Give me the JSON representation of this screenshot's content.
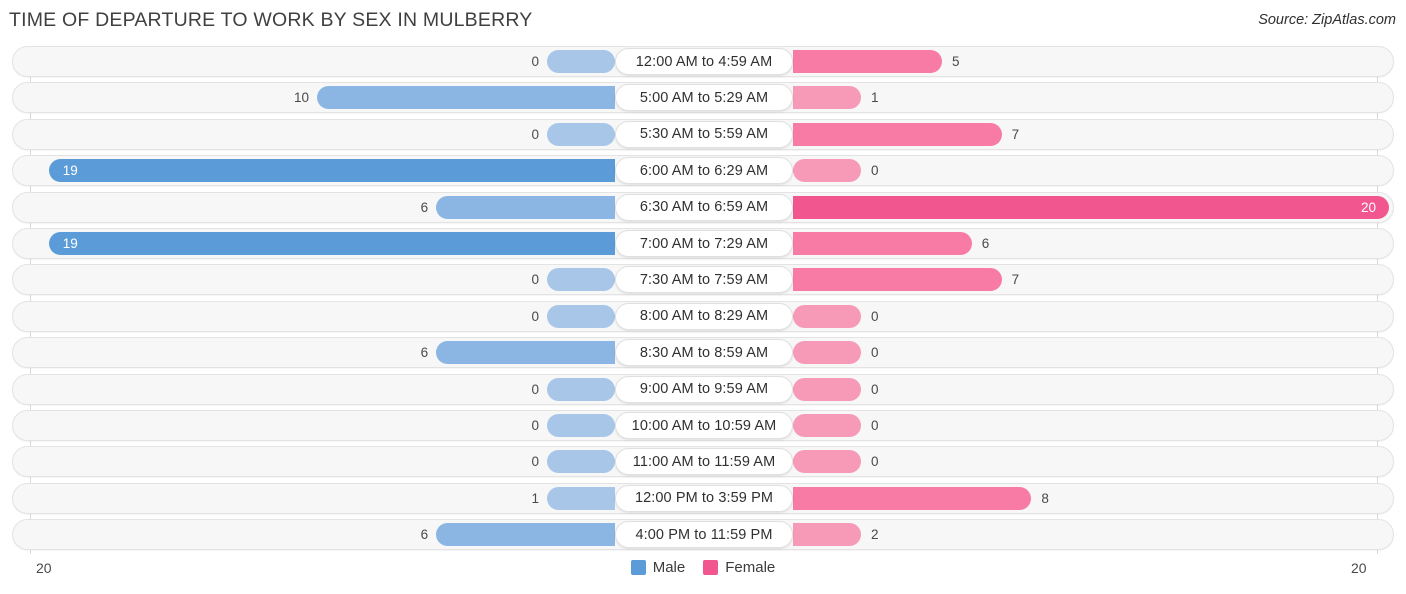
{
  "header": {
    "title": "TIME OF DEPARTURE TO WORK BY SEX IN MULBERRY",
    "source": "Source: ZipAtlas.com"
  },
  "legend": {
    "male_label": "Male",
    "female_label": "Female",
    "male_color": "#5b9bd8",
    "female_color": "#f2568f"
  },
  "axis": {
    "left_max": "20",
    "right_max": "20"
  },
  "colors": {
    "male_light": "#a8c6e8",
    "male_mid": "#8bb6e3",
    "male_dark": "#5b9bd8",
    "female_light": "#f79ab8",
    "female_mid": "#f77ba5",
    "female_dark": "#f2568f",
    "track_bg": "#f7f7f7",
    "track_border": "#e3e3e3",
    "gridline": "#d9d9d9"
  },
  "chart_data": {
    "type": "bar",
    "orientation": "horizontal-diverging",
    "title": "TIME OF DEPARTURE TO WORK BY SEX IN MULBERRY",
    "xlabel": "",
    "ylabel": "",
    "xlim": [
      20,
      20
    ],
    "grid": true,
    "legend_position": "bottom-center",
    "categories": [
      "12:00 AM to 4:59 AM",
      "5:00 AM to 5:29 AM",
      "5:30 AM to 5:59 AM",
      "6:00 AM to 6:29 AM",
      "6:30 AM to 6:59 AM",
      "7:00 AM to 7:29 AM",
      "7:30 AM to 7:59 AM",
      "8:00 AM to 8:29 AM",
      "8:30 AM to 8:59 AM",
      "9:00 AM to 9:59 AM",
      "10:00 AM to 10:59 AM",
      "11:00 AM to 11:59 AM",
      "12:00 PM to 3:59 PM",
      "4:00 PM to 11:59 PM"
    ],
    "series": [
      {
        "name": "Male",
        "values": [
          0,
          10,
          0,
          19,
          6,
          19,
          0,
          0,
          6,
          0,
          0,
          0,
          1,
          6
        ]
      },
      {
        "name": "Female",
        "values": [
          5,
          1,
          7,
          0,
          20,
          6,
          7,
          0,
          0,
          0,
          0,
          0,
          8,
          2
        ]
      }
    ]
  },
  "rows": [
    {
      "label": "12:00 AM to 4:59 AM",
      "male": "0",
      "female": "5"
    },
    {
      "label": "5:00 AM to 5:29 AM",
      "male": "10",
      "female": "1"
    },
    {
      "label": "5:30 AM to 5:59 AM",
      "male": "0",
      "female": "7"
    },
    {
      "label": "6:00 AM to 6:29 AM",
      "male": "19",
      "female": "0"
    },
    {
      "label": "6:30 AM to 6:59 AM",
      "male": "6",
      "female": "20"
    },
    {
      "label": "7:00 AM to 7:29 AM",
      "male": "19",
      "female": "6"
    },
    {
      "label": "7:30 AM to 7:59 AM",
      "male": "0",
      "female": "7"
    },
    {
      "label": "8:00 AM to 8:29 AM",
      "male": "0",
      "female": "0"
    },
    {
      "label": "8:30 AM to 8:59 AM",
      "male": "6",
      "female": "0"
    },
    {
      "label": "9:00 AM to 9:59 AM",
      "male": "0",
      "female": "0"
    },
    {
      "label": "10:00 AM to 10:59 AM",
      "male": "0",
      "female": "0"
    },
    {
      "label": "11:00 AM to 11:59 AM",
      "male": "0",
      "female": "0"
    },
    {
      "label": "12:00 PM to 3:59 PM",
      "male": "1",
      "female": "8"
    },
    {
      "label": "4:00 PM to 11:59 PM",
      "male": "6",
      "female": "2"
    }
  ]
}
